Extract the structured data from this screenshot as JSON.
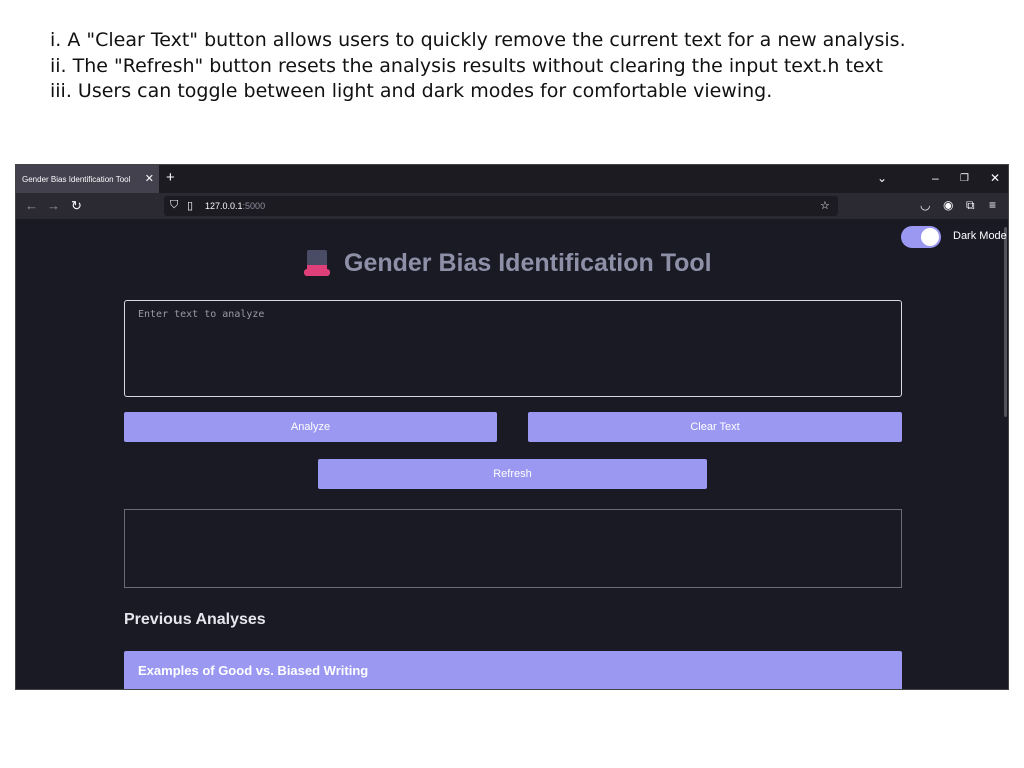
{
  "notes": [
    "i. A \"Clear Text\" button allows users to quickly remove the current text for a new analysis.",
    "ii. The \"Refresh\" button resets the analysis results without clearing the input text.h text",
    "iii. Users can toggle between light and dark modes for comfortable viewing."
  ],
  "browser": {
    "tab_title": "Gender Bias Identification Tool",
    "url_host": "127.0.0.1",
    "url_port": ":5000",
    "icons": [
      "close-icon",
      "new-tab-icon",
      "tab-list-icon",
      "minimize-icon",
      "restore-icon",
      "window-close-icon",
      "back-icon",
      "forward-icon",
      "reload-icon",
      "shield-icon",
      "page-icon",
      "bookmark-star-icon",
      "pocket-icon",
      "account-icon",
      "extensions-icon",
      "menu-icon"
    ]
  },
  "page": {
    "dark_mode_label": "Dark Mode",
    "dark_mode_on": true,
    "title": "Gender Bias Identification Tool",
    "title_icon": "top-hat-icon",
    "input_placeholder": "Enter text to analyze",
    "input_value": "",
    "analyze_label": "Analyze",
    "clear_label": "Clear Text",
    "refresh_label": "Refresh",
    "previous_heading": "Previous Analyses",
    "examples_label": "Examples of Good vs. Biased Writing"
  },
  "colors": {
    "accent": "#9b98f2",
    "page_bg": "#1a1a24",
    "title": "#8e90a8"
  }
}
